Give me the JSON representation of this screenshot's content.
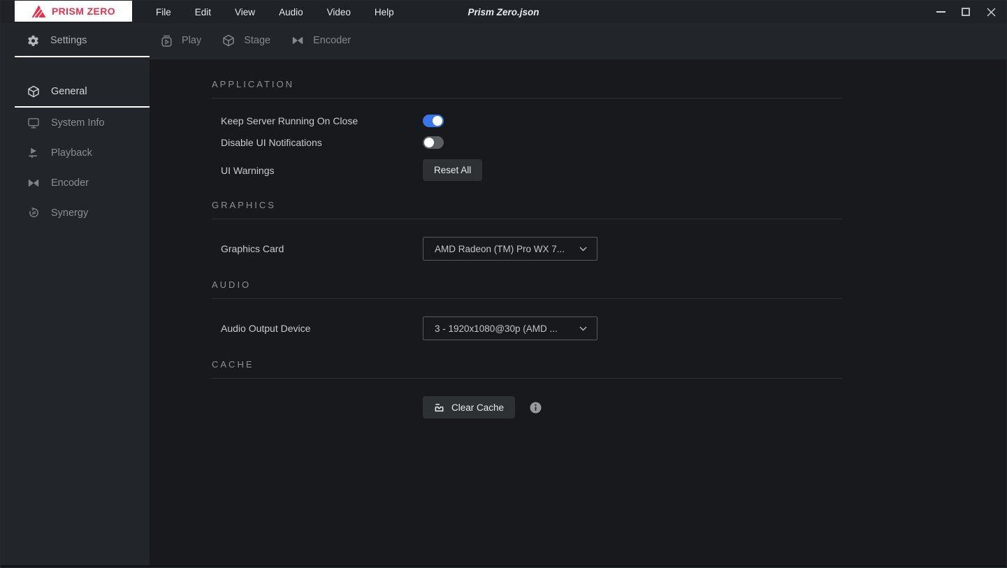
{
  "window": {
    "title": "Prism Zero.json"
  },
  "logo": {
    "text": "PRISM ZERO",
    "icon": "prism-triangle-icon",
    "color": "#e8314a"
  },
  "menu": {
    "items": [
      {
        "label": "File"
      },
      {
        "label": "Edit"
      },
      {
        "label": "View"
      },
      {
        "label": "Audio"
      },
      {
        "label": "Video"
      },
      {
        "label": "Help"
      }
    ]
  },
  "window_controls": {
    "minimize": "minimize-icon",
    "maximize": "maximize-icon",
    "close": "close-icon"
  },
  "settings_tab": {
    "label": "Settings",
    "icon": "gear-icon",
    "active": true
  },
  "workspace_tabs": [
    {
      "label": "Play",
      "icon": "play-icon"
    },
    {
      "label": "Stage",
      "icon": "cube-icon"
    },
    {
      "label": "Encoder",
      "icon": "encoder-bowtie-icon"
    }
  ],
  "sidebar": {
    "items": [
      {
        "label": "General",
        "icon": "cube-icon",
        "active": true
      },
      {
        "label": "System Info",
        "icon": "monitor-icon",
        "active": false
      },
      {
        "label": "Playback",
        "icon": "playback-icon",
        "active": false
      },
      {
        "label": "Encoder",
        "icon": "encoder-bowtie-icon",
        "active": false
      },
      {
        "label": "Synergy",
        "icon": "synergy-swirl-icon",
        "active": false
      }
    ]
  },
  "sections": {
    "application": {
      "title": "APPLICATION",
      "rows": [
        {
          "label": "Keep Server Running On Close",
          "control": "toggle",
          "value": "on"
        },
        {
          "label": "Disable UI Notifications",
          "control": "toggle",
          "value": "off"
        },
        {
          "label": "UI Warnings",
          "control": "button",
          "button_label": "Reset All"
        }
      ]
    },
    "graphics": {
      "title": "GRAPHICS",
      "row": {
        "label": "Graphics Card",
        "control": "dropdown",
        "value": "AMD Radeon (TM) Pro WX 7..."
      }
    },
    "audio": {
      "title": "AUDIO",
      "row": {
        "label": "Audio Output Device",
        "control": "dropdown",
        "value": "3 - 1920x1080@30p (AMD ..."
      }
    },
    "cache": {
      "title": "CACHE",
      "button_label": "Clear Cache",
      "button_icon": "clear-cache-icon",
      "info_icon": "info-icon"
    }
  },
  "colors": {
    "accent_blue": "#3b76e8",
    "logo_red": "#e8314a",
    "toggle_off_gray": "#5b5e61",
    "chrome_bg": "#22262a",
    "content_bg": "#17191d"
  }
}
